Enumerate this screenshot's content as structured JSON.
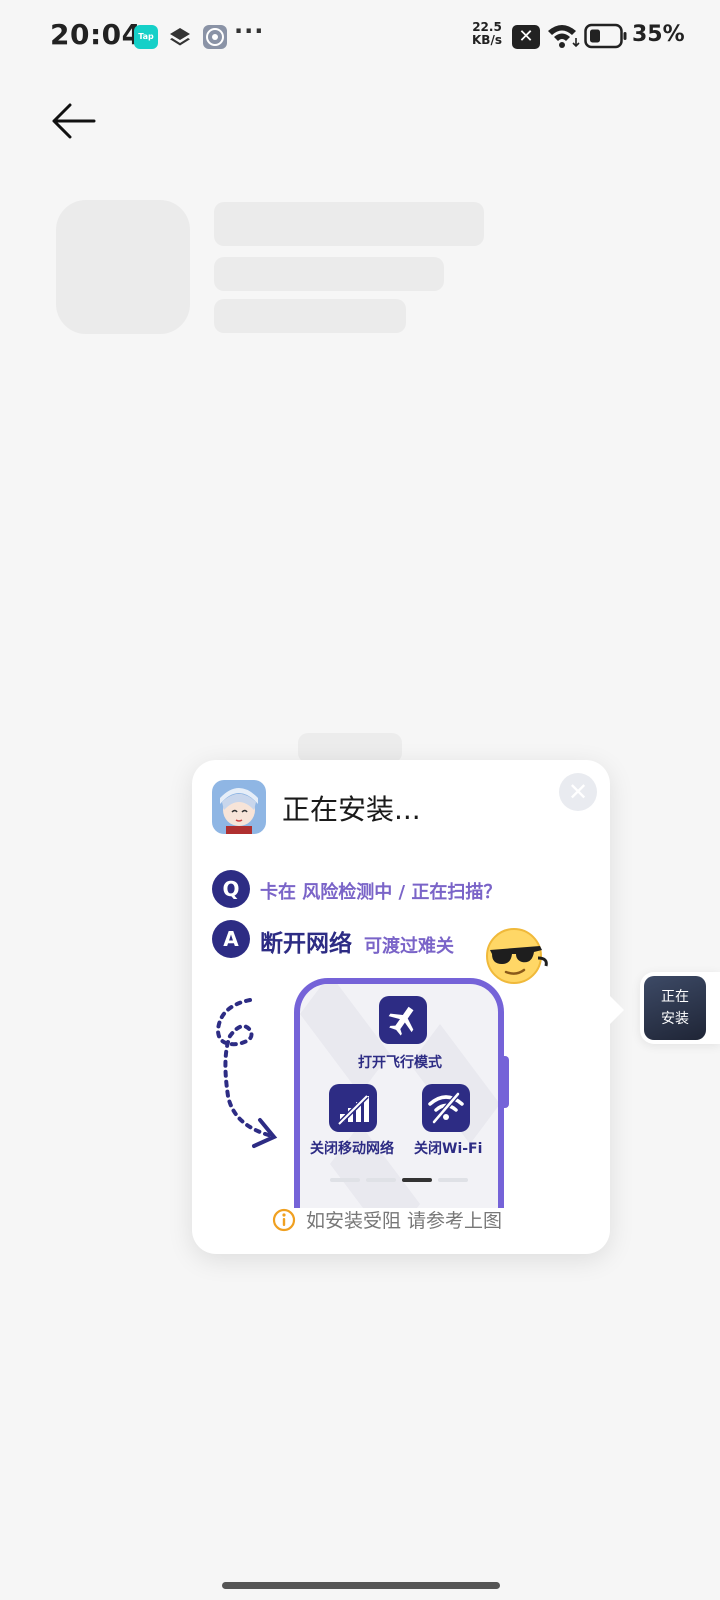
{
  "status_bar": {
    "time": "20:04",
    "tap_app_label": "Tap",
    "net_speed_value": "22.5",
    "net_speed_unit": "KB/s",
    "battery": "35%",
    "icons": [
      "tap-app-icon",
      "layers-icon",
      "settings-icon",
      "more-icon",
      "x-close-icon",
      "wifi-icon",
      "battery-icon"
    ]
  },
  "header": {
    "back_icon": "arrow-left-icon"
  },
  "popup": {
    "title": "正在安装...",
    "close_icon": "close-icon",
    "q_badge": "Q",
    "a_badge": "A",
    "question": "卡在 风险检测中 / 正在扫描？",
    "answer_main": "断开网络",
    "answer_sub": "可渡过难关",
    "tiles": {
      "airplane": "打开飞行模式",
      "mobile": "关闭移动网络",
      "wifi": "关闭Wi-Fi"
    },
    "pager": {
      "count": 4,
      "active": 3
    },
    "hint": "如安装受阻 请参考上图"
  },
  "side_float": {
    "label_line1": "正在",
    "label_line2": "安装"
  },
  "colors": {
    "accent_dark": "#2d2c84",
    "accent_purple": "#7563d8",
    "text_purple": "#7a64c8",
    "hint_orange": "#f0a020"
  }
}
